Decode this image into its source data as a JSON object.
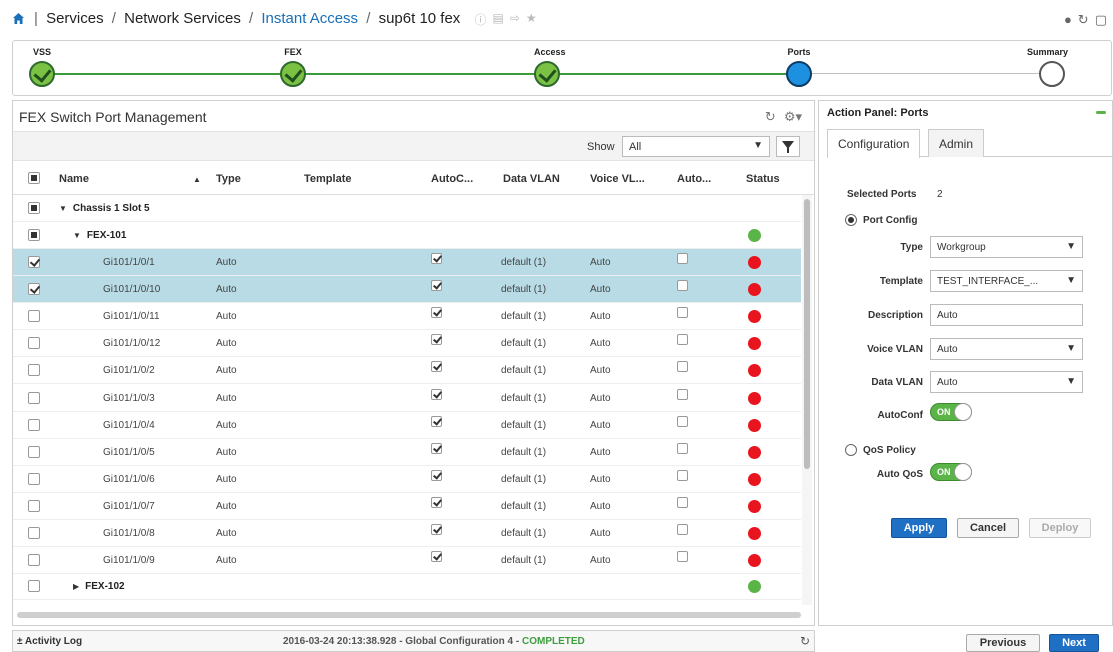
{
  "breadcrumb": {
    "items": [
      "Services",
      "Network Services",
      "Instant Access",
      "sup6t 10 fex"
    ],
    "separator": "/"
  },
  "header_icons": [
    "info-icon",
    "save-icon",
    "export-icon",
    "star-icon"
  ],
  "top_right_icons": [
    "help-icon",
    "refresh-icon",
    "window-icon"
  ],
  "wizard": {
    "steps": [
      {
        "label": "VSS",
        "state": "done"
      },
      {
        "label": "FEX",
        "state": "done"
      },
      {
        "label": "Access",
        "state": "done"
      },
      {
        "label": "Ports",
        "state": "active"
      },
      {
        "label": "Summary",
        "state": "todo"
      }
    ]
  },
  "left_panel": {
    "title": "FEX Switch Port Management",
    "show_label": "Show",
    "show_value": "All",
    "columns": [
      "Name",
      "Type",
      "Template",
      "AutoC...",
      "Data VLAN",
      "Voice VL...",
      "Auto...",
      "Status"
    ],
    "groups": {
      "chassis": "Chassis 1 Slot 5",
      "fex101": "FEX-101",
      "fex102": "FEX-102"
    },
    "rows": [
      {
        "name": "Gi101/1/0/1",
        "type": "Auto",
        "autoconf": true,
        "data_vlan": "default (1)",
        "voice_vlan": "Auto",
        "auto": false,
        "status": "red",
        "selected": true
      },
      {
        "name": "Gi101/1/0/10",
        "type": "Auto",
        "autoconf": true,
        "data_vlan": "default (1)",
        "voice_vlan": "Auto",
        "auto": false,
        "status": "red",
        "selected": true
      },
      {
        "name": "Gi101/1/0/11",
        "type": "Auto",
        "autoconf": true,
        "data_vlan": "default (1)",
        "voice_vlan": "Auto",
        "auto": false,
        "status": "red",
        "selected": false
      },
      {
        "name": "Gi101/1/0/12",
        "type": "Auto",
        "autoconf": true,
        "data_vlan": "default (1)",
        "voice_vlan": "Auto",
        "auto": false,
        "status": "red",
        "selected": false
      },
      {
        "name": "Gi101/1/0/2",
        "type": "Auto",
        "autoconf": true,
        "data_vlan": "default (1)",
        "voice_vlan": "Auto",
        "auto": false,
        "status": "red",
        "selected": false
      },
      {
        "name": "Gi101/1/0/3",
        "type": "Auto",
        "autoconf": true,
        "data_vlan": "default (1)",
        "voice_vlan": "Auto",
        "auto": false,
        "status": "red",
        "selected": false
      },
      {
        "name": "Gi101/1/0/4",
        "type": "Auto",
        "autoconf": true,
        "data_vlan": "default (1)",
        "voice_vlan": "Auto",
        "auto": false,
        "status": "red",
        "selected": false
      },
      {
        "name": "Gi101/1/0/5",
        "type": "Auto",
        "autoconf": true,
        "data_vlan": "default (1)",
        "voice_vlan": "Auto",
        "auto": false,
        "status": "red",
        "selected": false
      },
      {
        "name": "Gi101/1/0/6",
        "type": "Auto",
        "autoconf": true,
        "data_vlan": "default (1)",
        "voice_vlan": "Auto",
        "auto": false,
        "status": "red",
        "selected": false
      },
      {
        "name": "Gi101/1/0/7",
        "type": "Auto",
        "autoconf": true,
        "data_vlan": "default (1)",
        "voice_vlan": "Auto",
        "auto": false,
        "status": "red",
        "selected": false
      },
      {
        "name": "Gi101/1/0/8",
        "type": "Auto",
        "autoconf": true,
        "data_vlan": "default (1)",
        "voice_vlan": "Auto",
        "auto": false,
        "status": "red",
        "selected": false
      },
      {
        "name": "Gi101/1/0/9",
        "type": "Auto",
        "autoconf": true,
        "data_vlan": "default (1)",
        "voice_vlan": "Auto",
        "auto": false,
        "status": "red",
        "selected": false
      }
    ]
  },
  "action_panel": {
    "title": "Action Panel: Ports",
    "tabs": [
      "Configuration",
      "Admin"
    ],
    "selected_ports_label": "Selected Ports",
    "selected_ports_value": "2",
    "port_config_label": "Port Config",
    "type_label": "Type",
    "type_value": "Workgroup",
    "template_label": "Template",
    "template_value": "TEST_INTERFACE_...",
    "description_label": "Description",
    "description_value": "Auto",
    "voice_vlan_label": "Voice VLAN",
    "voice_vlan_value": "Auto",
    "data_vlan_label": "Data VLAN",
    "data_vlan_value": "Auto",
    "autoconf_label": "AutoConf",
    "autoconf_toggle": "ON",
    "qos_label": "QoS Policy",
    "auto_qos_label": "Auto QoS",
    "auto_qos_toggle": "ON",
    "apply": "Apply",
    "cancel": "Cancel",
    "deploy": "Deploy"
  },
  "footer": {
    "activity_log": "Activity Log",
    "message": "2016-03-24 20:13:38.928 - Global Configuration 4 - ",
    "status": "COMPLETED"
  },
  "nav": {
    "previous": "Previous",
    "next": "Next"
  },
  "colors": {
    "link": "#1a70b8",
    "selected_row": "#b8dbe6",
    "status_red": "#e8141e",
    "status_green": "#5ab447",
    "primary_button": "#1f6fc5",
    "completed": "#3e9e3e"
  }
}
